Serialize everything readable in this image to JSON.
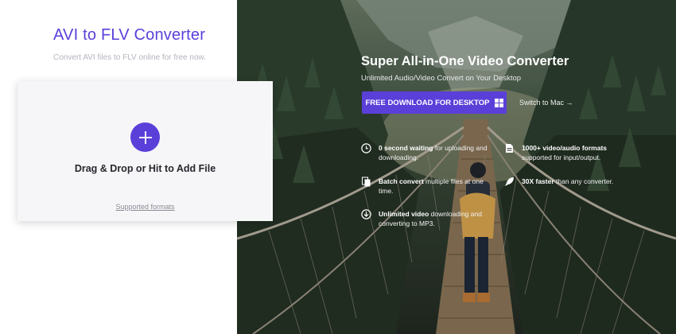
{
  "left": {
    "title": "AVI to FLV Converter",
    "subtitle": "Convert AVI files to FLV online for free now."
  },
  "upload": {
    "add_icon": "plus-icon",
    "drop_label": "Drag & Drop or Hit to Add File",
    "formats_link": "Supported formats"
  },
  "hero": {
    "title": "Super All-in-One Video Converter",
    "subtitle": "Unlimited Audio/Video Convert on Your Desktop",
    "download_label": "FREE DOWNLOAD FOR DESKTOP",
    "download_icon": "windows-icon",
    "switch_label": "Switch to Mac →",
    "features": [
      {
        "icon": "clock-icon",
        "bold": "0 second waiting",
        "text": " for uploading and downloading."
      },
      {
        "icon": "file-formats-icon",
        "bold": "1000+ video/audio formats",
        "text": " supported for input/output."
      },
      {
        "icon": "files-icon",
        "bold": "Batch convert",
        "text": " multiple files at one time."
      },
      {
        "icon": "rocket-icon",
        "bold": "30X faster",
        "text": " than any converter."
      },
      {
        "icon": "download-icon",
        "bold": "Unlimited video",
        "text": " downloading and converting to MP3."
      }
    ]
  },
  "colors": {
    "accent": "#5b3fd9",
    "card_background": "#f6f6f8"
  }
}
